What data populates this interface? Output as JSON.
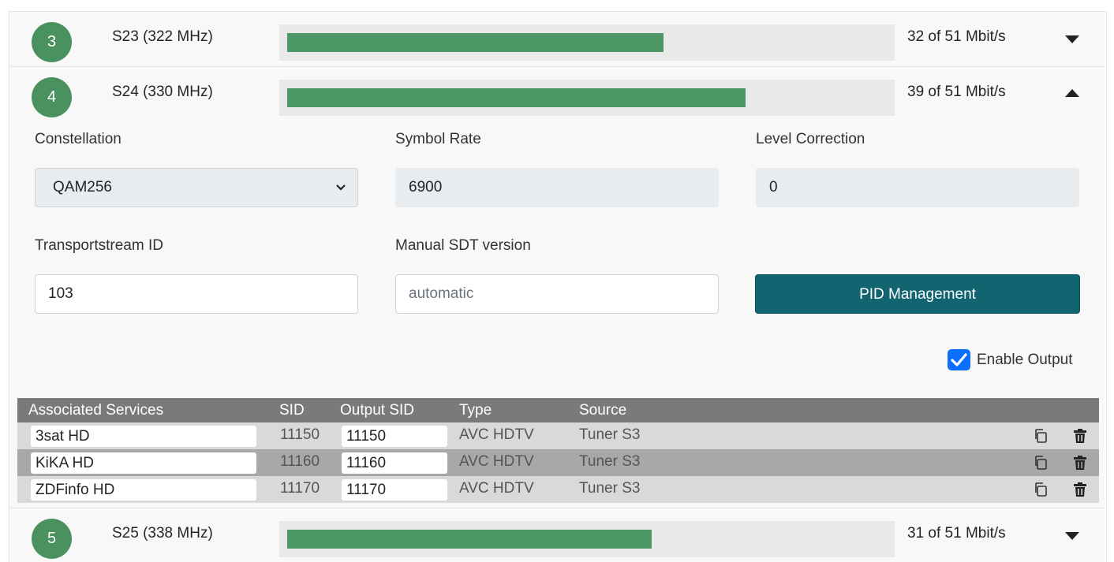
{
  "channels": [
    {
      "number": "3",
      "label": "S23 (322 MHz)",
      "rate": "32 of 51 Mbit/s",
      "fill": 0.6275,
      "expanded": false
    },
    {
      "number": "4",
      "label": "S24 (330 MHz)",
      "rate": "39 of 51 Mbit/s",
      "fill": 0.7647,
      "expanded": true
    },
    {
      "number": "5",
      "label": "S25 (338 MHz)",
      "rate": "31 of 51 Mbit/s",
      "fill": 0.6078,
      "expanded": false
    }
  ],
  "settings": {
    "constellation_label": "Constellation",
    "constellation_value": "QAM256",
    "symbol_rate_label": "Symbol Rate",
    "symbol_rate_value": "6900",
    "level_correction_label": "Level Correction",
    "level_correction_value": "0",
    "tsid_label": "Transportstream ID",
    "tsid_value": "103",
    "sdt_label": "Manual SDT version",
    "sdt_placeholder": "automatic",
    "pid_button": "PID Management",
    "enable_output_label": "Enable Output",
    "enable_output_checked": true
  },
  "services": {
    "headers": {
      "name": "Associated Services",
      "sid": "SID",
      "output_sid": "Output SID",
      "type": "Type",
      "source": "Source"
    },
    "rows": [
      {
        "name": "3sat HD",
        "sid": "11150",
        "output_sid": "11150",
        "type": "AVC HDTV",
        "source": "Tuner S3"
      },
      {
        "name": "KiKA HD",
        "sid": "11160",
        "output_sid": "11160",
        "type": "AVC HDTV",
        "source": "Tuner S3"
      },
      {
        "name": "ZDFinfo HD",
        "sid": "11170",
        "output_sid": "11170",
        "type": "AVC HDTV",
        "source": "Tuner S3"
      }
    ]
  },
  "icons": {
    "collapse": "caret-down-icon",
    "expand": "caret-up-icon",
    "select": "chevron-down-icon",
    "check": "check-icon",
    "copy": "copy-icon",
    "delete": "trash-icon"
  },
  "colors": {
    "badge": "#4a9160",
    "bar_fill": "#4e9766",
    "button": "#116470",
    "checkbox": "#0b6efd",
    "table_header": "#7a7a7a"
  }
}
